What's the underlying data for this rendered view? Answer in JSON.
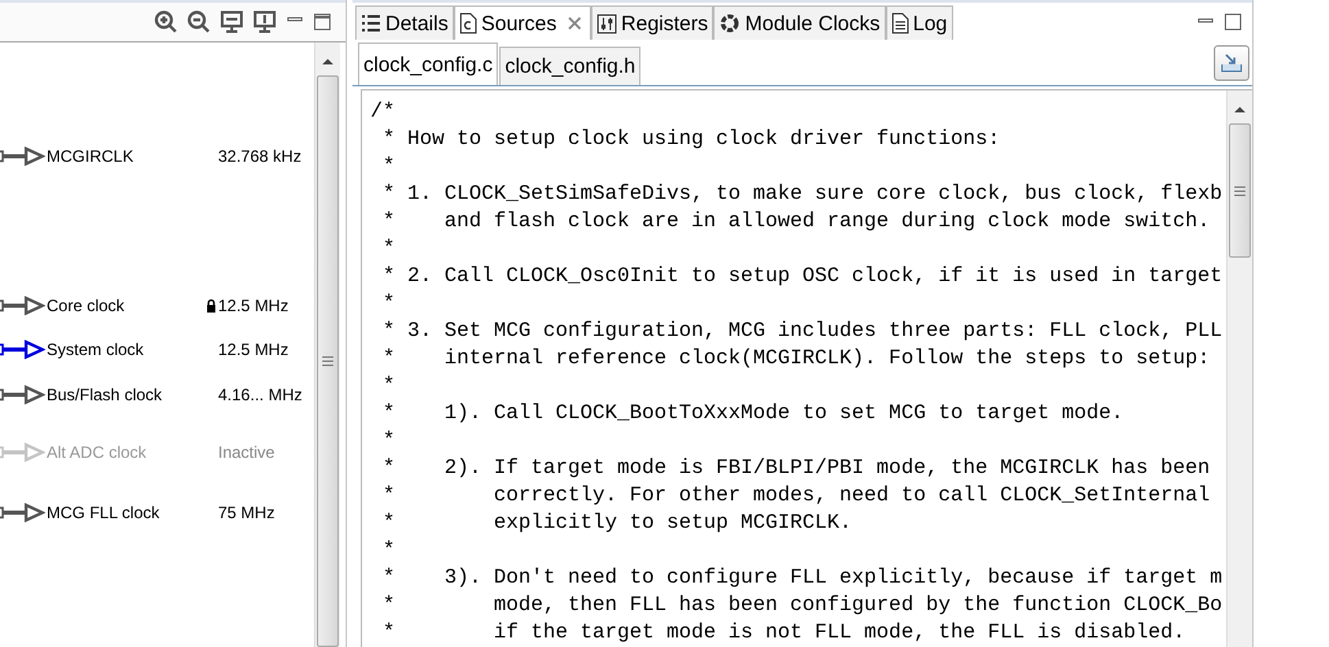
{
  "clock_diagram": {
    "outputs": [
      {
        "name": "MCGIRCLK",
        "value": "32.768 kHz",
        "selected": false,
        "disabled": false,
        "locked": false
      },
      {
        "name": "Core clock",
        "value": "12.5 MHz",
        "selected": false,
        "disabled": false,
        "locked": true
      },
      {
        "name": "System clock",
        "value": "12.5 MHz",
        "selected": true,
        "disabled": false,
        "locked": false
      },
      {
        "name": "Bus/Flash clock",
        "value": "4.16... MHz",
        "selected": false,
        "disabled": false,
        "locked": false
      },
      {
        "name": "Alt ADC clock",
        "value": "Inactive",
        "selected": false,
        "disabled": true,
        "locked": false
      },
      {
        "name": "MCG FLL clock",
        "value": "75 MHz",
        "selected": false,
        "disabled": false,
        "locked": false
      }
    ]
  },
  "view_tabs": [
    {
      "label": "Details",
      "selected": false,
      "closable": false
    },
    {
      "label": "Sources",
      "selected": true,
      "closable": true
    },
    {
      "label": "Registers",
      "selected": false,
      "closable": false
    },
    {
      "label": "Module Clocks",
      "selected": false,
      "closable": false
    },
    {
      "label": "Log",
      "selected": false,
      "closable": false
    }
  ],
  "file_tabs": [
    {
      "label": "clock_config.c",
      "selected": true
    },
    {
      "label": "clock_config.h",
      "selected": false
    }
  ],
  "code_lines": [
    "/*",
    " * How to setup clock using clock driver functions:",
    " *",
    " * 1. CLOCK_SetSimSafeDivs, to make sure core clock, bus clock, flexb",
    " *    and flash clock are in allowed range during clock mode switch.",
    " *",
    " * 2. Call CLOCK_Osc0Init to setup OSC clock, if it is used in target",
    " *",
    " * 3. Set MCG configuration, MCG includes three parts: FLL clock, PLL",
    " *    internal reference clock(MCGIRCLK). Follow the steps to setup:",
    " *",
    " *    1). Call CLOCK_BootToXxxMode to set MCG to target mode.",
    " *",
    " *    2). If target mode is FBI/BLPI/PBI mode, the MCGIRCLK has been",
    " *        correctly. For other modes, need to call CLOCK_SetInternal",
    " *        explicitly to setup MCGIRCLK.",
    " *",
    " *    3). Don't need to configure FLL explicitly, because if target m",
    " *        mode, then FLL has been configured by the function CLOCK_Bo",
    " *        if the target mode is not FLL mode, the FLL is disabled."
  ]
}
